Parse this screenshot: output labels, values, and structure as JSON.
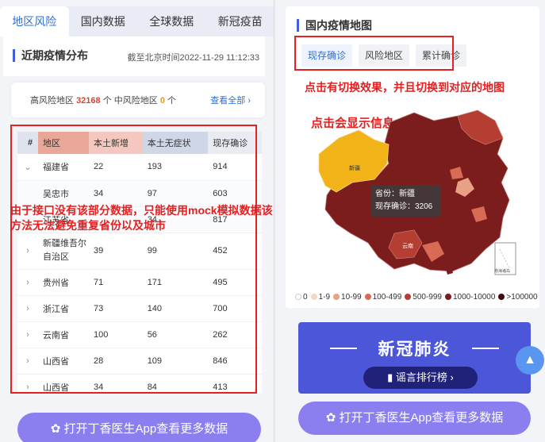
{
  "left": {
    "tabs": [
      "地区风险",
      "国内数据",
      "全球数据",
      "新冠疫苗"
    ],
    "section_title": "近期疫情分布",
    "update_time": "截至北京时间2022-11-29 11:12:33",
    "risk": {
      "high_label": "高风险地区",
      "high_value": "32168",
      "high_unit": "个",
      "mid_label": "中风险地区",
      "mid_value": "0",
      "mid_unit": "个",
      "view_all": "查看全部"
    },
    "table": {
      "headers": [
        "#",
        "地区",
        "本土新增",
        "本土无症状",
        "现存确诊"
      ],
      "rows": [
        {
          "arrow": "⌄",
          "name": "福建省",
          "a": "22",
          "b": "193",
          "c": "914"
        },
        {
          "arrow": "",
          "name": "吴忠市",
          "a": "34",
          "b": "97",
          "c": "603"
        },
        {
          "arrow": "",
          "name": "江苏省",
          "a": "",
          "b": "34",
          "c": "817"
        },
        {
          "arrow": "›",
          "name": "新疆维吾尔自治区",
          "a": "39",
          "b": "99",
          "c": "452"
        },
        {
          "arrow": "›",
          "name": "贵州省",
          "a": "71",
          "b": "171",
          "c": "495"
        },
        {
          "arrow": "›",
          "name": "浙江省",
          "a": "73",
          "b": "140",
          "c": "700"
        },
        {
          "arrow": "›",
          "name": "云南省",
          "a": "100",
          "b": "56",
          "c": "262"
        },
        {
          "arrow": "›",
          "name": "山西省",
          "a": "28",
          "b": "109",
          "b2": "",
          "c": "846"
        },
        {
          "arrow": "›",
          "name": "山西省",
          "a": "34",
          "b": "84",
          "c": "413"
        }
      ]
    },
    "annotation": "由于接口没有该部分数据，只能使用mock模拟数据该方法无法避免重复省份以及城市",
    "app_button": "打开丁香医生App查看更多数据"
  },
  "right": {
    "title": "国内疫情地图",
    "tabs": [
      "现存确诊",
      "风险地区",
      "累计确诊"
    ],
    "annotation_tabs": "点击有切换效果，并且切换到对应的地图",
    "annotation_map": "点击会显示信息",
    "tooltip_line1": "省份：新疆",
    "tooltip_line2": "现存确诊：3206",
    "map_labels": {
      "xinjiang": "新疆",
      "yunnan": "云南",
      "south_sea": "南海诸岛"
    },
    "legend": [
      "0",
      "1-9",
      "10-99",
      "100-499",
      "500-999",
      "1000-10000",
      ">100000"
    ],
    "legend_colors": [
      "#ffffff",
      "#f6d6c4",
      "#e8a184",
      "#d96b55",
      "#b53e33",
      "#7c1d1d",
      "#3e0a0a"
    ],
    "banner_title": "新冠肺炎",
    "banner_rumor": "谣言排行榜",
    "app_button": "打开丁香医生App查看更多数据"
  }
}
